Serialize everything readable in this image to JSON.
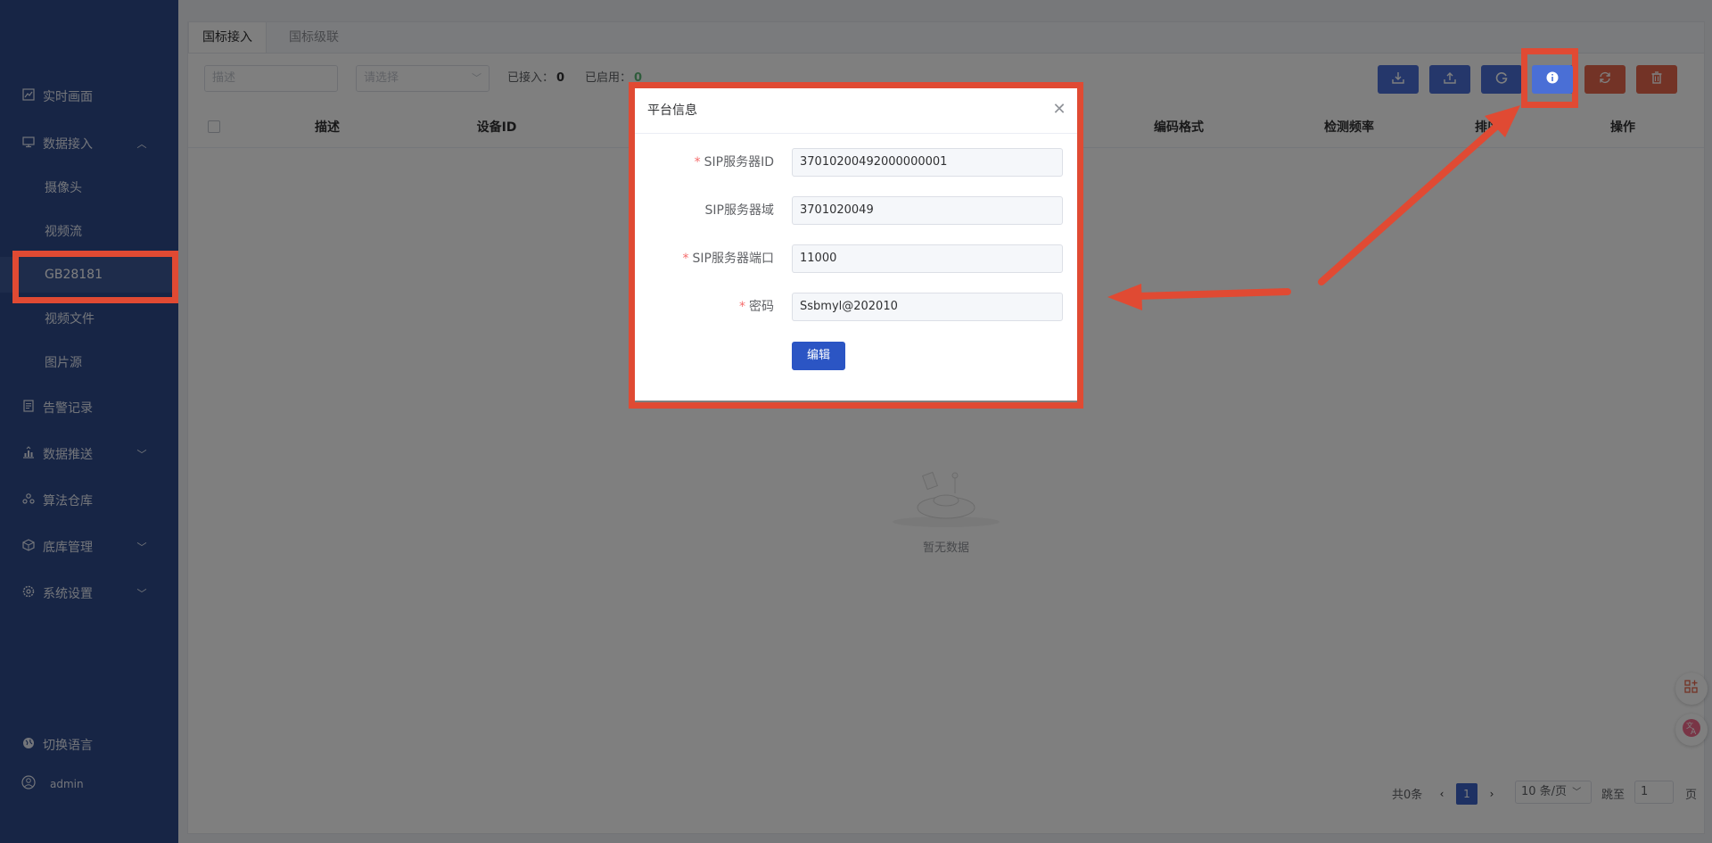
{
  "sidebar": {
    "items": [
      {
        "icon": "chart-line-icon",
        "label": "实时画面"
      },
      {
        "icon": "monitor-icon",
        "label": "数据接入",
        "expanded": true
      },
      {
        "icon": "document-icon",
        "label": "告警记录"
      },
      {
        "icon": "upload-chart-icon",
        "label": "数据推送"
      },
      {
        "icon": "cluster-icon",
        "label": "算法仓库"
      },
      {
        "icon": "box-icon",
        "label": "底库管理"
      },
      {
        "icon": "gear-icon",
        "label": "系统设置"
      }
    ],
    "sub_items": [
      {
        "label": "摄像头"
      },
      {
        "label": "视频流"
      },
      {
        "label": "GB28181",
        "active": true
      },
      {
        "label": "视频文件"
      },
      {
        "label": "图片源"
      }
    ],
    "footer": {
      "language_label": "切换语言",
      "user_label": "admin"
    }
  },
  "tabs": [
    {
      "label": "国标接入",
      "active": true
    },
    {
      "label": "国标级联"
    }
  ],
  "toolbar": {
    "desc_placeholder": "描述",
    "select_placeholder": "请选择",
    "connected_label": "已接入：",
    "connected_value": "0",
    "enabled_label": "已启用：",
    "enabled_value": "0"
  },
  "table": {
    "columns": [
      "描述",
      "设备ID",
      "编码格式",
      "检测频率",
      "排序",
      "操作"
    ],
    "empty_text": "暂无数据"
  },
  "pagination": {
    "total": "共0条",
    "current_page": "1",
    "page_size": "10 条/页",
    "jump_label": "跳至",
    "jump_value": "1",
    "page_suffix": "页"
  },
  "modal": {
    "title": "平台信息",
    "fields": [
      {
        "label": "SIP服务器ID",
        "required": true,
        "value": "37010200492000000001"
      },
      {
        "label": "SIP服务器域",
        "required": false,
        "value": "3701020049"
      },
      {
        "label": "SIP服务器端口",
        "required": true,
        "value": "11000"
      },
      {
        "label": "密码",
        "required": true,
        "value": "Ssbmyl@202010"
      }
    ],
    "edit_label": "编辑"
  },
  "colors": {
    "sidebar_bg": "#2e4a8b",
    "accent_blue": "#4a6fd6",
    "danger": "#e7664c",
    "annotation_red": "#e04a33"
  }
}
